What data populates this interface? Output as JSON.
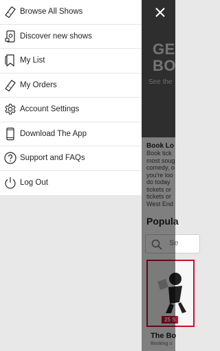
{
  "menu": {
    "items": [
      {
        "label": "Browse All Shows",
        "icon": "ticket-icon"
      },
      {
        "label": "Discover new shows",
        "icon": "phone-ticket-icon"
      },
      {
        "label": "My List",
        "icon": "bookmark-icon"
      },
      {
        "label": "My Orders",
        "icon": "ticket-icon"
      },
      {
        "label": "Account Settings",
        "icon": "gear-icon"
      },
      {
        "label": "Download The App",
        "icon": "smartphone-icon"
      },
      {
        "label": "Support and FAQs",
        "icon": "question-circle-icon"
      },
      {
        "label": "Log Out",
        "icon": "power-icon"
      }
    ]
  },
  "background": {
    "hero_title": "GE\nBO",
    "hero_subtitle": "See the",
    "section_heading": "Book Lo",
    "paragraph_lines": [
      "Book tick",
      "most soug",
      "comedy, o",
      "you're loo",
      "do today",
      "tickets or",
      "tickets or",
      "West End"
    ],
    "popular_heading": "Popula",
    "search_placeholder": "Se",
    "card_badge": "25 S",
    "show_title": "The Bo",
    "show_subtitle": "Booking u"
  },
  "colors": {
    "accent": "#c8102e",
    "menu_background": "#ffffff",
    "overlay": "#00000080"
  }
}
